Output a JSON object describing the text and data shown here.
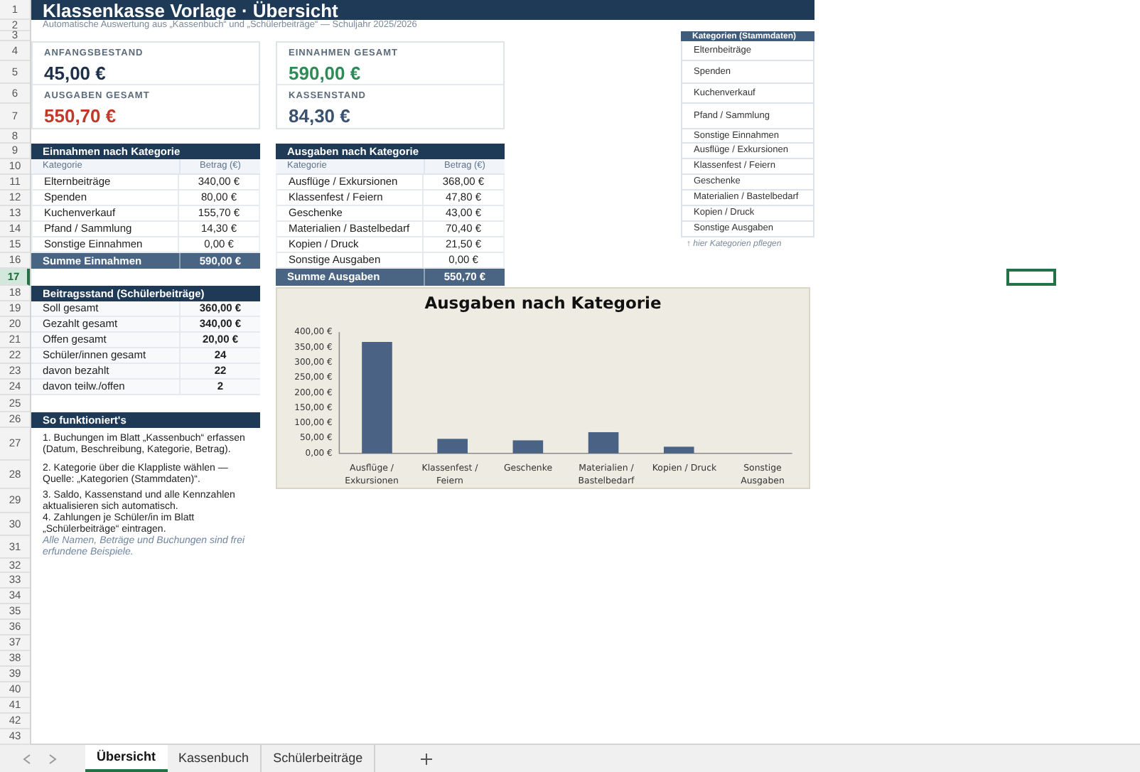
{
  "title": "Klassenkasse Vorlage · Übersicht",
  "subtitle": "Automatische Auswertung aus „Kassenbuch“ und „Schülerbeiträge“ — Schuljahr 2025/2026",
  "kpi_cards": [
    {
      "items": [
        {
          "label": "ANFANGSBESTAND",
          "value": "45,00 €",
          "color": "#1e2f48"
        },
        {
          "label": "AUSGABEN GESAMT",
          "value": "550,70 €",
          "color": "#c0392b"
        }
      ]
    },
    {
      "items": [
        {
          "label": "EINNAHMEN GESAMT",
          "value": "590,00 €",
          "color": "#2e8b57"
        },
        {
          "label": "KASSENSTAND",
          "value": "84,30 €",
          "color": "#3b5170"
        }
      ]
    }
  ],
  "income_table": {
    "title": "Einnahmen nach Kategorie",
    "columns": [
      "Kategorie",
      "Betrag (€)"
    ],
    "rows": [
      {
        "category": "Elternbeiträge",
        "amount": "340,00 €"
      },
      {
        "category": "Spenden",
        "amount": "80,00 €"
      },
      {
        "category": "Kuchenverkauf",
        "amount": "155,70 €"
      },
      {
        "category": "Pfand / Sammlung",
        "amount": "14,30 €"
      },
      {
        "category": "Sonstige Einnahmen",
        "amount": "0,00 €"
      }
    ],
    "total": {
      "label": "Summe Einnahmen",
      "amount": "590,00 €"
    }
  },
  "expense_table": {
    "title": "Ausgaben nach Kategorie",
    "columns": [
      "Kategorie",
      "Betrag (€)"
    ],
    "rows": [
      {
        "category": "Ausflüge / Exkursionen",
        "amount": "368,00 €"
      },
      {
        "category": "Klassenfest / Feiern",
        "amount": "47,80 €"
      },
      {
        "category": "Geschenke",
        "amount": "43,00 €"
      },
      {
        "category": "Materialien / Bastelbedarf",
        "amount": "70,40 €"
      },
      {
        "category": "Kopien / Druck",
        "amount": "21,50 €"
      },
      {
        "category": "Sonstige Ausgaben",
        "amount": "0,00 €"
      }
    ],
    "total": {
      "label": "Summe Ausgaben",
      "amount": "550,70 €"
    }
  },
  "contributions": {
    "title": "Beitragsstand (Schülerbeiträge)",
    "rows": [
      {
        "label": "Soll gesamt",
        "value": "360,00 €"
      },
      {
        "label": "Gezahlt gesamt",
        "value": "340,00 €"
      },
      {
        "label": "Offen gesamt",
        "value": "20,00 €"
      },
      {
        "label": "Schüler/innen gesamt",
        "value": "24"
      },
      {
        "label": "davon bezahlt",
        "value": "22"
      },
      {
        "label": "davon teilw./offen",
        "value": "2"
      }
    ]
  },
  "how_to": {
    "title": "So funktioniert's",
    "steps": [
      "1.  Buchungen im Blatt „Kassenbuch“ erfassen (Datum, Beschreibung, Kategorie, Betrag).",
      "2.  Kategorie über die Klappliste wählen — Quelle: „Kategorien (Stammdaten)“.",
      "3.  Saldo, Kassenstand und alle Kennzahlen aktualisieren sich automatisch.",
      "4.  Zahlungen je Schüler/in im Blatt „Schülerbeiträge“ eintragen."
    ],
    "note": "Alle Namen, Beträge und Buchungen sind frei erfundene Beispiele."
  },
  "categories_master": {
    "title": "Kategorien (Stammdaten)",
    "items": [
      "Elternbeiträge",
      "Spenden",
      "Kuchenverkauf",
      "Pfand / Sammlung",
      "Sonstige Einnahmen",
      "Ausflüge / Exkursionen",
      "Klassenfest / Feiern",
      "Geschenke",
      "Materialien / Bastelbedarf",
      "Kopien / Druck",
      "Sonstige Ausgaben"
    ],
    "hint": "↑ hier Kategorien pflegen"
  },
  "chart_data": {
    "type": "bar",
    "title": "Ausgaben nach Kategorie",
    "categories": [
      "Ausflüge / Exkursionen",
      "Klassenfest / Feiern",
      "Geschenke",
      "Materialien / Bastelbedarf",
      "Kopien / Druck",
      "Sonstige Ausgaben"
    ],
    "series": [
      {
        "color": "#4a6283",
        "values": [
          368,
          48,
          43,
          70,
          22,
          0
        ]
      }
    ],
    "ylim": [
      0,
      400
    ],
    "yticks": [
      {
        "value": 0,
        "label": "0,00 €"
      },
      {
        "value": 50,
        "label": "50,00 €"
      },
      {
        "value": 100,
        "label": "100,00 €"
      },
      {
        "value": 150,
        "label": "150,00 €"
      },
      {
        "value": 200,
        "label": "200,00 €"
      },
      {
        "value": 250,
        "label": "250,00 €"
      },
      {
        "value": 300,
        "label": "300,00 €"
      },
      {
        "value": 350,
        "label": "350,00 €"
      },
      {
        "value": 400,
        "label": "400,00 €"
      }
    ]
  },
  "row_headers": [
    {
      "label": "1",
      "selected": false
    },
    {
      "label": "2",
      "selected": false
    },
    {
      "label": "3",
      "selected": false
    },
    {
      "label": "4",
      "selected": false
    },
    {
      "label": "5",
      "selected": false
    },
    {
      "label": "6",
      "selected": false
    },
    {
      "label": "7",
      "selected": false
    },
    {
      "label": "8",
      "selected": false
    },
    {
      "label": "9",
      "selected": false
    },
    {
      "label": "10",
      "selected": false
    },
    {
      "label": "11",
      "selected": false
    },
    {
      "label": "12",
      "selected": false
    },
    {
      "label": "13",
      "selected": false
    },
    {
      "label": "14",
      "selected": false
    },
    {
      "label": "15",
      "selected": false
    },
    {
      "label": "16",
      "selected": false
    },
    {
      "label": "17",
      "selected": true
    },
    {
      "label": "18",
      "selected": false
    },
    {
      "label": "19",
      "selected": false
    },
    {
      "label": "20",
      "selected": false
    },
    {
      "label": "21",
      "selected": false
    },
    {
      "label": "22",
      "selected": false
    },
    {
      "label": "23",
      "selected": false
    },
    {
      "label": "24",
      "selected": false
    },
    {
      "label": "25",
      "selected": false
    },
    {
      "label": "26",
      "selected": false
    },
    {
      "label": "27",
      "selected": false
    },
    {
      "label": "28",
      "selected": false
    },
    {
      "label": "29",
      "selected": false
    },
    {
      "label": "30",
      "selected": false
    },
    {
      "label": "31",
      "selected": false
    },
    {
      "label": "32",
      "selected": false
    },
    {
      "label": "33",
      "selected": false
    },
    {
      "label": "34",
      "selected": false
    },
    {
      "label": "35",
      "selected": false
    },
    {
      "label": "36",
      "selected": false
    },
    {
      "label": "37",
      "selected": false
    },
    {
      "label": "38",
      "selected": false
    },
    {
      "label": "39",
      "selected": false
    },
    {
      "label": "40",
      "selected": false
    },
    {
      "label": "41",
      "selected": false
    },
    {
      "label": "42",
      "selected": false
    },
    {
      "label": "43",
      "selected": false
    }
  ],
  "sheet_tabs": [
    {
      "label": "Übersicht",
      "selected": true
    },
    {
      "label": "Kassenbuch",
      "selected": false
    },
    {
      "label": "Schülerbeiträge",
      "selected": false
    }
  ]
}
